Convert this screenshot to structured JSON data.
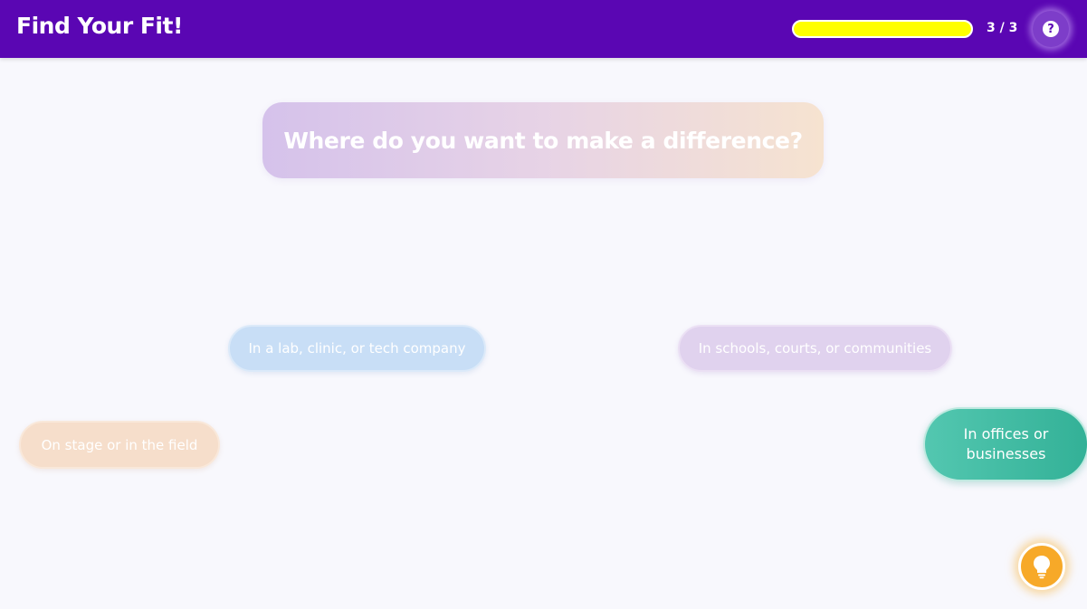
{
  "header": {
    "title": "Find Your Fit!",
    "progress": {
      "fraction": 1.0,
      "label": "3 / 3"
    },
    "help_icon": "question-circle-icon",
    "bar_color": "#5a06b3",
    "progress_color": "#ffff00"
  },
  "quiz": {
    "question": "Where do you want to make a difference?",
    "options": [
      {
        "label": "In a lab, clinic, or tech company",
        "color": "#c8def6"
      },
      {
        "label": "In schools, courts, or communities",
        "color": "#e0d2ee"
      },
      {
        "label": "On stage or in the field",
        "color": "#f6decb"
      },
      {
        "label": "In offices or businesses",
        "color": "#33b197"
      }
    ]
  },
  "hint": {
    "icon": "lightbulb-icon",
    "color": "#f7a928"
  }
}
